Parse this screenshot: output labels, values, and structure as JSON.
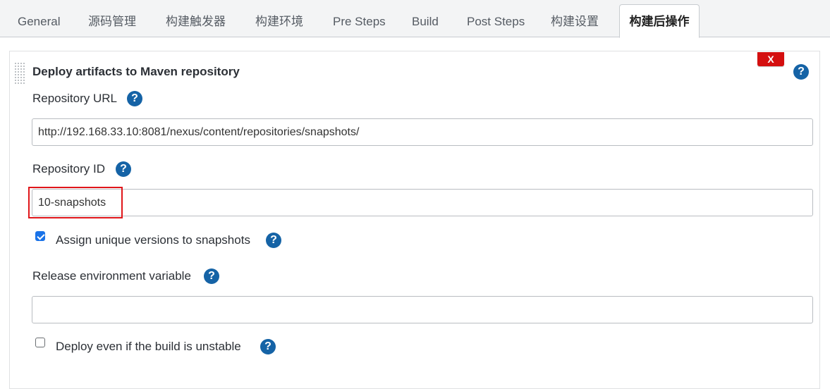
{
  "tabs": [
    {
      "label": "General"
    },
    {
      "label": "源码管理"
    },
    {
      "label": "构建触发器"
    },
    {
      "label": "构建环境"
    },
    {
      "label": "Pre Steps"
    },
    {
      "label": "Build"
    },
    {
      "label": "Post Steps"
    },
    {
      "label": "构建设置"
    },
    {
      "label": "构建后操作",
      "active": true
    }
  ],
  "section": {
    "title": "Deploy artifacts to Maven repository",
    "delete_label": "X",
    "help_glyph": "?"
  },
  "fields": {
    "repository_url": {
      "label": "Repository URL",
      "value": "http://192.168.33.10:8081/nexus/content/repositories/snapshots/"
    },
    "repository_id": {
      "label": "Repository ID",
      "value": "10-snapshots"
    },
    "unique_versions": {
      "label": "Assign unique versions to snapshots",
      "checked": true
    },
    "release_env_var": {
      "label": "Release environment variable",
      "value": ""
    },
    "deploy_unstable": {
      "label": "Deploy even if the build is unstable",
      "checked": false
    }
  },
  "colors": {
    "help_icon": "#1563a6",
    "delete_button": "#d40f0f",
    "highlight_box": "#e0161a",
    "checkbox_checked": "#1a73e8"
  },
  "icons": [
    "help-icon",
    "drag-handle-icon",
    "close-icon",
    "checkmark-icon"
  ]
}
